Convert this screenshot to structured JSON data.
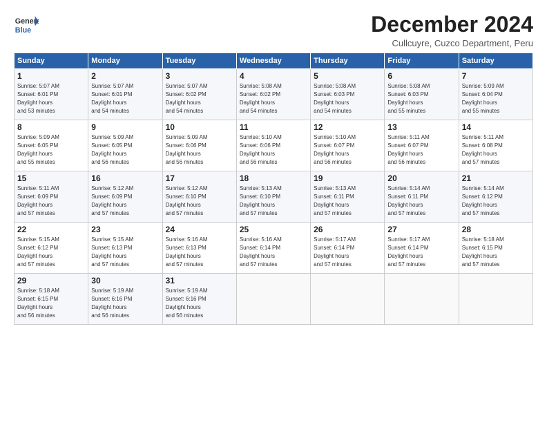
{
  "header": {
    "logo_line1": "General",
    "logo_line2": "Blue",
    "title": "December 2024",
    "location": "Cullcuyre, Cuzco Department, Peru"
  },
  "weekdays": [
    "Sunday",
    "Monday",
    "Tuesday",
    "Wednesday",
    "Thursday",
    "Friday",
    "Saturday"
  ],
  "weeks": [
    [
      {
        "day": "1",
        "sunrise": "5:07 AM",
        "sunset": "6:01 PM",
        "daylight": "12 hours and 53 minutes"
      },
      {
        "day": "2",
        "sunrise": "5:07 AM",
        "sunset": "6:01 PM",
        "daylight": "12 hours and 54 minutes"
      },
      {
        "day": "3",
        "sunrise": "5:07 AM",
        "sunset": "6:02 PM",
        "daylight": "12 hours and 54 minutes"
      },
      {
        "day": "4",
        "sunrise": "5:08 AM",
        "sunset": "6:02 PM",
        "daylight": "12 hours and 54 minutes"
      },
      {
        "day": "5",
        "sunrise": "5:08 AM",
        "sunset": "6:03 PM",
        "daylight": "12 hours and 54 minutes"
      },
      {
        "day": "6",
        "sunrise": "5:08 AM",
        "sunset": "6:03 PM",
        "daylight": "12 hours and 55 minutes"
      },
      {
        "day": "7",
        "sunrise": "5:09 AM",
        "sunset": "6:04 PM",
        "daylight": "12 hours and 55 minutes"
      }
    ],
    [
      {
        "day": "8",
        "sunrise": "5:09 AM",
        "sunset": "6:05 PM",
        "daylight": "12 hours and 55 minutes"
      },
      {
        "day": "9",
        "sunrise": "5:09 AM",
        "sunset": "6:05 PM",
        "daylight": "12 hours and 56 minutes"
      },
      {
        "day": "10",
        "sunrise": "5:09 AM",
        "sunset": "6:06 PM",
        "daylight": "12 hours and 56 minutes"
      },
      {
        "day": "11",
        "sunrise": "5:10 AM",
        "sunset": "6:06 PM",
        "daylight": "12 hours and 56 minutes"
      },
      {
        "day": "12",
        "sunrise": "5:10 AM",
        "sunset": "6:07 PM",
        "daylight": "12 hours and 56 minutes"
      },
      {
        "day": "13",
        "sunrise": "5:11 AM",
        "sunset": "6:07 PM",
        "daylight": "12 hours and 56 minutes"
      },
      {
        "day": "14",
        "sunrise": "5:11 AM",
        "sunset": "6:08 PM",
        "daylight": "12 hours and 57 minutes"
      }
    ],
    [
      {
        "day": "15",
        "sunrise": "5:11 AM",
        "sunset": "6:09 PM",
        "daylight": "12 hours and 57 minutes"
      },
      {
        "day": "16",
        "sunrise": "5:12 AM",
        "sunset": "6:09 PM",
        "daylight": "12 hours and 57 minutes"
      },
      {
        "day": "17",
        "sunrise": "5:12 AM",
        "sunset": "6:10 PM",
        "daylight": "12 hours and 57 minutes"
      },
      {
        "day": "18",
        "sunrise": "5:13 AM",
        "sunset": "6:10 PM",
        "daylight": "12 hours and 57 minutes"
      },
      {
        "day": "19",
        "sunrise": "5:13 AM",
        "sunset": "6:11 PM",
        "daylight": "12 hours and 57 minutes"
      },
      {
        "day": "20",
        "sunrise": "5:14 AM",
        "sunset": "6:11 PM",
        "daylight": "12 hours and 57 minutes"
      },
      {
        "day": "21",
        "sunrise": "5:14 AM",
        "sunset": "6:12 PM",
        "daylight": "12 hours and 57 minutes"
      }
    ],
    [
      {
        "day": "22",
        "sunrise": "5:15 AM",
        "sunset": "6:12 PM",
        "daylight": "12 hours and 57 minutes"
      },
      {
        "day": "23",
        "sunrise": "5:15 AM",
        "sunset": "6:13 PM",
        "daylight": "12 hours and 57 minutes"
      },
      {
        "day": "24",
        "sunrise": "5:16 AM",
        "sunset": "6:13 PM",
        "daylight": "12 hours and 57 minutes"
      },
      {
        "day": "25",
        "sunrise": "5:16 AM",
        "sunset": "6:14 PM",
        "daylight": "12 hours and 57 minutes"
      },
      {
        "day": "26",
        "sunrise": "5:17 AM",
        "sunset": "6:14 PM",
        "daylight": "12 hours and 57 minutes"
      },
      {
        "day": "27",
        "sunrise": "5:17 AM",
        "sunset": "6:14 PM",
        "daylight": "12 hours and 57 minutes"
      },
      {
        "day": "28",
        "sunrise": "5:18 AM",
        "sunset": "6:15 PM",
        "daylight": "12 hours and 57 minutes"
      }
    ],
    [
      {
        "day": "29",
        "sunrise": "5:18 AM",
        "sunset": "6:15 PM",
        "daylight": "12 hours and 56 minutes"
      },
      {
        "day": "30",
        "sunrise": "5:19 AM",
        "sunset": "6:16 PM",
        "daylight": "12 hours and 56 minutes"
      },
      {
        "day": "31",
        "sunrise": "5:19 AM",
        "sunset": "6:16 PM",
        "daylight": "12 hours and 56 minutes"
      },
      null,
      null,
      null,
      null
    ]
  ]
}
